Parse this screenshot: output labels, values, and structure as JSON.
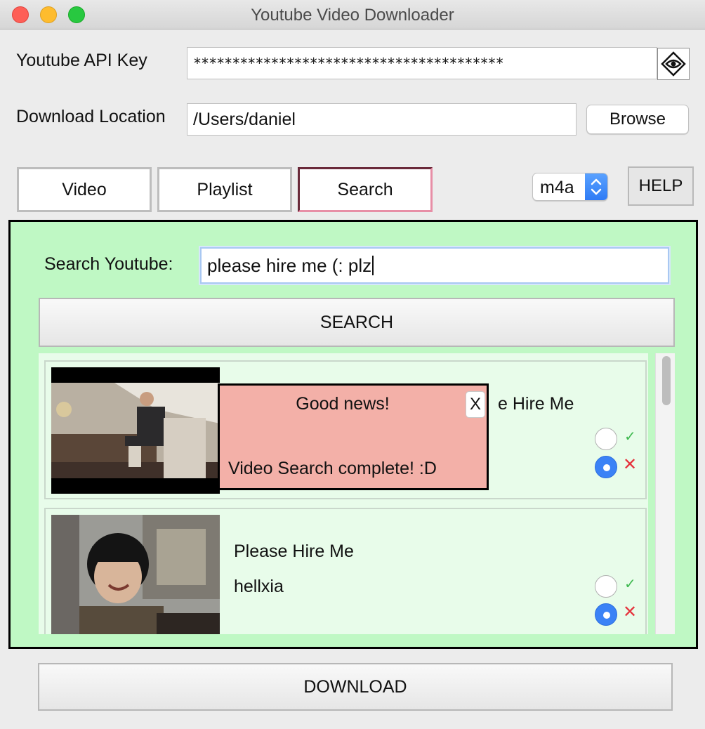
{
  "window": {
    "title": "Youtube Video Downloader"
  },
  "settings": {
    "api_key_label": "Youtube API Key",
    "api_key_value": "****************************************",
    "download_location_label": "Download Location",
    "download_location_value": "/Users/daniel",
    "browse_label": "Browse"
  },
  "tabs": [
    {
      "label": "Video",
      "active": false
    },
    {
      "label": "Playlist",
      "active": false
    },
    {
      "label": "Search",
      "active": true
    }
  ],
  "format": {
    "selected": "m4a"
  },
  "help_label": "HELP",
  "search": {
    "label": "Search Youtube:",
    "query": "please hire me (: plz",
    "button_label": "SEARCH"
  },
  "results": [
    {
      "title": "Please Hire Me",
      "channel": "",
      "visible_title_fragment": "e Hire Me",
      "selected": "reject"
    },
    {
      "title": "Please Hire Me",
      "channel": "hellxia",
      "selected": "reject"
    }
  ],
  "popup": {
    "title": "Good news!",
    "message": "Video Search complete! :D",
    "close_label": "X"
  },
  "download_label": "DOWNLOAD",
  "colors": {
    "panel_bg": "#bff8c4",
    "results_bg": "#e8fcea",
    "popup_bg": "#f3b0a8",
    "active_tab_border": "#e78ea6",
    "radio_selected": "#3b82f6",
    "check_green": "#3fb950",
    "cross_red": "#e5323c"
  },
  "icons": {
    "api_key_toggle": "eye-icon",
    "accept": "check-icon",
    "reject": "cross-icon"
  }
}
